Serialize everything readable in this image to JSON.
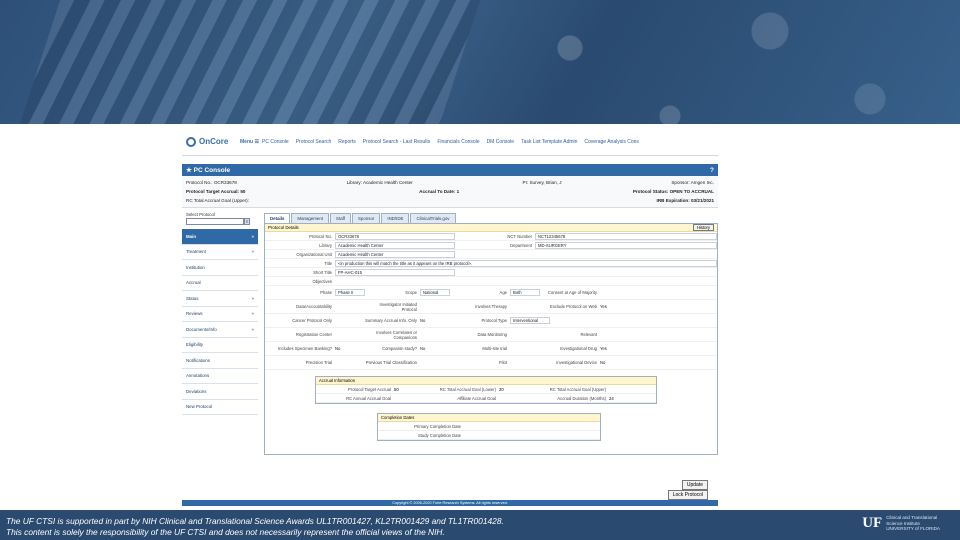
{
  "appbar": {
    "logo_text": "OnCore",
    "menu_label": "Menu ☰",
    "nav": [
      "PC Console",
      "Protocol Search",
      "Reports",
      "Protocol Search - Last Results",
      "Financials Console",
      "DM Console",
      "Task List Template Admin",
      "Coverage Analysis Cons"
    ]
  },
  "console": {
    "title": "PC Console",
    "help": "?"
  },
  "summary": {
    "protocol_no": "Protocol No.: OCR33678",
    "library": "Library: Academic Health Center",
    "pi": "PI: Survey, Brian, J",
    "sponsor": "Sponsor: Amgen Inc.",
    "target_accrual": "Protocol Target Accrual: 50",
    "accrual_to_date": "Accrual To Date: 1",
    "status": "Protocol Status: OPEN TO ACCRUAL",
    "rc_goal": "RC Total Accrual Goal (Upper):",
    "irb": "IRB Expiration: 03/21/2021"
  },
  "leftnav": {
    "select_label": "Select Protocol",
    "items": [
      {
        "label": "Main",
        "mark": "»",
        "active": true
      },
      {
        "label": "Treatment",
        "mark": "»"
      },
      {
        "label": "Institution",
        "mark": ""
      },
      {
        "label": "Accrual",
        "mark": ""
      },
      {
        "label": "Status",
        "mark": "»"
      },
      {
        "label": "Reviews",
        "mark": "»"
      },
      {
        "label": "Documents/Info",
        "mark": "»"
      },
      {
        "label": "Eligibility",
        "mark": ""
      },
      {
        "label": "Notifications",
        "mark": ""
      },
      {
        "label": "Annotations",
        "mark": ""
      },
      {
        "label": "Deviations",
        "mark": ""
      },
      {
        "label": "New Protocol",
        "mark": ""
      }
    ]
  },
  "tabs": [
    "Details",
    "Management",
    "Staff",
    "Sponsor",
    "IND/IDE",
    "ClinicalTrials.gov"
  ],
  "details": {
    "header": "Protocol Details",
    "history": "History",
    "protocol_no_label": "Protocol No.",
    "protocol_no": "OCR33678",
    "nct_label": "NCT Number",
    "nct": "NCT12345678",
    "library_label": "Library",
    "library": "Academic Health Center",
    "dept_label": "Department",
    "dept": "MD-SURGERY",
    "org_label": "Organizational Unit",
    "org": "Academic Health Center",
    "title_label": "Title",
    "title": "<in production this will match the title as it appears on the IRB protocol>.",
    "short_label": "Short Title",
    "short": "FP-AHC-015",
    "objectives_label": "Objectives",
    "phase_label": "Phase",
    "phase": "Phase II",
    "scope_label": "Scope",
    "scope": "National",
    "age_label": "Age",
    "age": "Both",
    "consent_label": "Consent at Age of Majority",
    "dt_label": "Data/Accountability",
    "inv_label": "Investigator Initiated Protocol",
    "therapy_label": "Involves Therapy",
    "exclude_label": "Exclude Protocol on Web",
    "exclude": "Yes",
    "cancer_label": "Cancer Protocol Only",
    "summary_label": "Summary Accrual Info. Only",
    "summary": "No",
    "type_label": "Protocol Type",
    "type": "Interventional",
    "reg_label": "Registration Center",
    "corr_label": "Involves Correlates or Companions",
    "dm_label": "Data Monitoring",
    "relevant_label": "Relevant",
    "specimen_label": "Includes Specimen Banking?",
    "specimen": "No",
    "companion_label": "Companion study?",
    "companion": "No",
    "multi_label": "Multi-site trial",
    "ide_label": "Investigational Drug",
    "ide": "Yes",
    "precision_label": "Precision Trial",
    "prev_label": "Previous Trial Classification",
    "pilot_label": "Pilot",
    "device_label": "Investigational Device",
    "device": "No"
  },
  "accrual": {
    "header": "Accrual Information",
    "target_label": "Protocol Target Accrual",
    "target": "50",
    "rc_lower_label": "RC Total Accrual Goal (Lower)",
    "rc_lower": "20",
    "rc_upper_label": "RC Total Accrual Goal (Upper)",
    "annual_label": "RC Annual Accrual Goal",
    "affiliate_label": "Affiliate Accrual Goal",
    "duration_label": "Accrual Duration (Months)",
    "duration": "24"
  },
  "completion": {
    "header": "Completion Dates",
    "primary": "Primary Completion Date",
    "study": "Study Completion Date"
  },
  "buttons": {
    "update": "Update",
    "lock": "Lock Protocol"
  },
  "copyright": "Copyright © 2005-2020 Forte Research Systems. All rights reserved.",
  "footer": {
    "line1": "The UF CTSI is supported in part by NIH Clinical and Translational Science Awards UL1TR001427, KL2TR001429 and TL1TR001428.",
    "line2": "This content is solely the responsibility of the UF CTSI and does not necessarily represent the official views of the NIH.",
    "uf_mark": "UF",
    "uf_line1": "Clinical and Translational",
    "uf_line2": "Science Institute",
    "uf_line3": "UNIVERSITY of FLORIDA"
  },
  "colors": {
    "brand_blue": "#2f6aa7",
    "banner": "#2a4a70",
    "highlight": "#fff6cf"
  }
}
